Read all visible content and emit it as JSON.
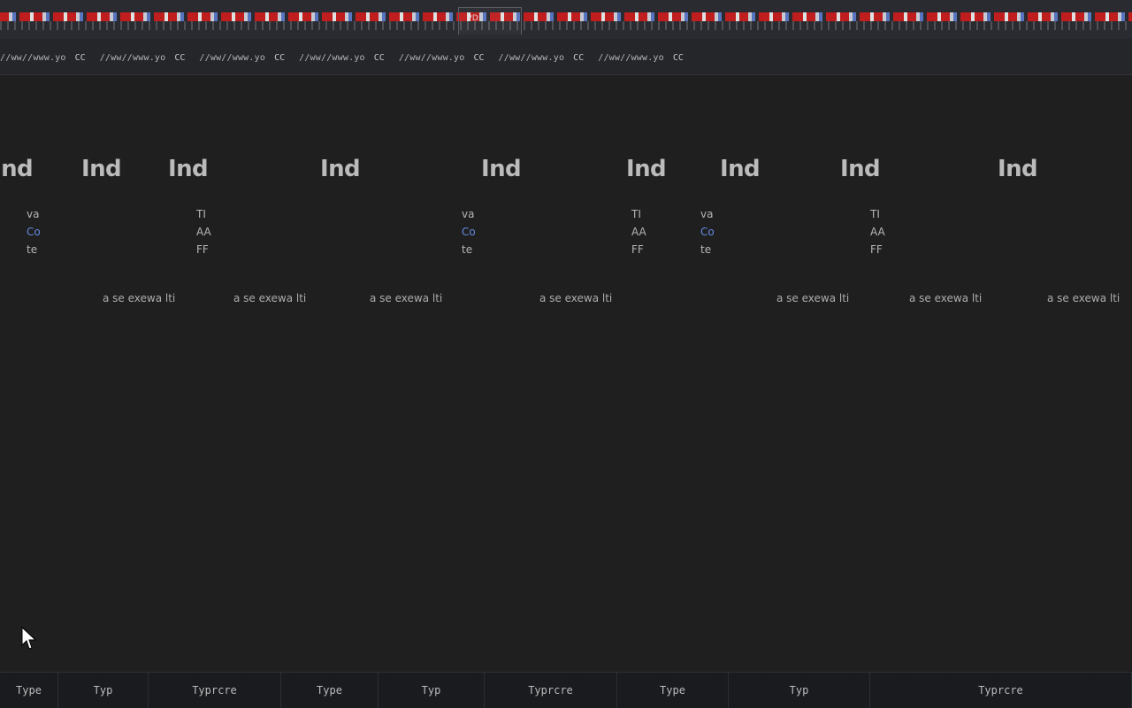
{
  "window": {
    "active_tab_label": "PD"
  },
  "toolbar": {
    "url_fragment": "//ww//www.yo",
    "cc_fragment": "CC"
  },
  "content": {
    "ghost_heading_fragment": "Ind",
    "ghost_lines": [
      {
        "a": "va",
        "b": "Co",
        "c": "te"
      },
      {
        "a": "TI",
        "b": "AA",
        "c": "FF"
      }
    ],
    "ghost_bottom_fragment": "a se   exewa  lti"
  },
  "taskbar": {
    "items": [
      {
        "label": "Type"
      },
      {
        "label": "Typ"
      },
      {
        "label": "Typrcre"
      },
      {
        "label": "Type"
      },
      {
        "label": "Typ"
      },
      {
        "label": "Typrcre"
      },
      {
        "label": "Type"
      },
      {
        "label": "Typ"
      },
      {
        "label": "Typrcre"
      }
    ]
  },
  "colors": {
    "bg": "#1f1f1f",
    "tabstrip": "#2a2b31",
    "urlbar": "#25262a",
    "taskbar": "#1a1b1f",
    "accent_red": "#c81d1d",
    "accent_blue": "#6f9cff"
  },
  "icons": {
    "cursor": "mouse-pointer-icon"
  }
}
